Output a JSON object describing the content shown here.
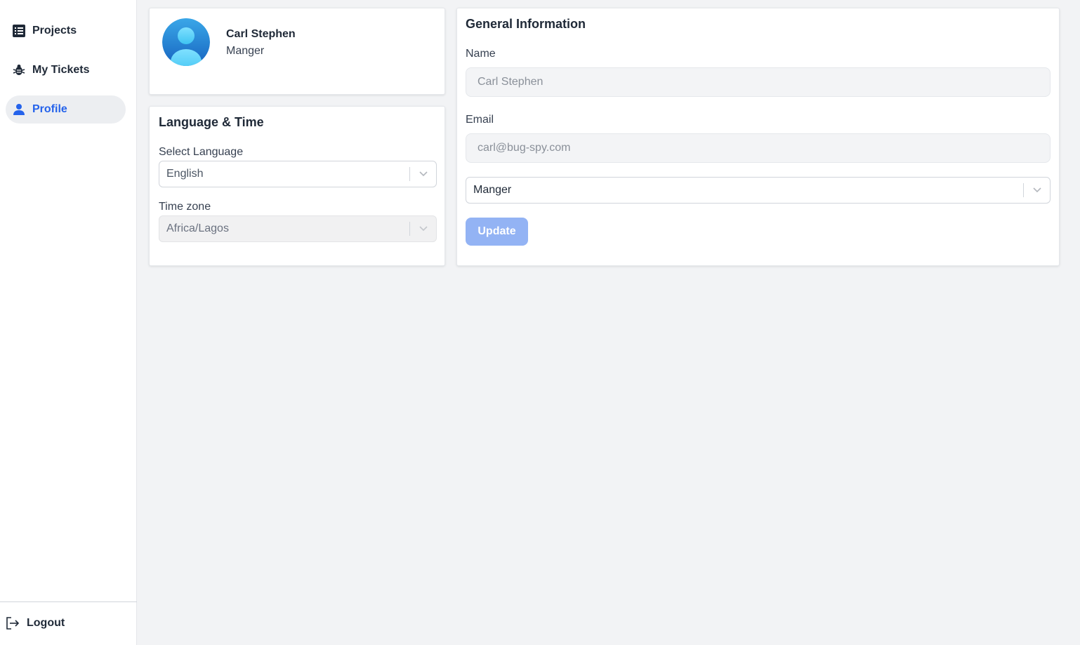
{
  "sidebar": {
    "items": [
      {
        "label": "Projects",
        "icon": "list-icon"
      },
      {
        "label": "My Tickets",
        "icon": "bug-icon"
      },
      {
        "label": "Profile",
        "icon": "user-icon",
        "active": true
      }
    ],
    "logout_label": "Logout"
  },
  "profile": {
    "name": "Carl Stephen",
    "role": "Manger"
  },
  "language_time": {
    "title": "Language & Time",
    "language_label": "Select Language",
    "language_value": "English",
    "timezone_label": "Time zone",
    "timezone_value": "Africa/Lagos"
  },
  "general_info": {
    "title": "General Information",
    "name_label": "Name",
    "name_value": "Carl Stephen",
    "email_label": "Email",
    "email_value": "carl@bug-spy.com",
    "role_value": "Manger",
    "update_label": "Update"
  },
  "colors": {
    "accent": "#2563eb",
    "update_button": "#93b3f4",
    "background": "#f2f3f5"
  }
}
